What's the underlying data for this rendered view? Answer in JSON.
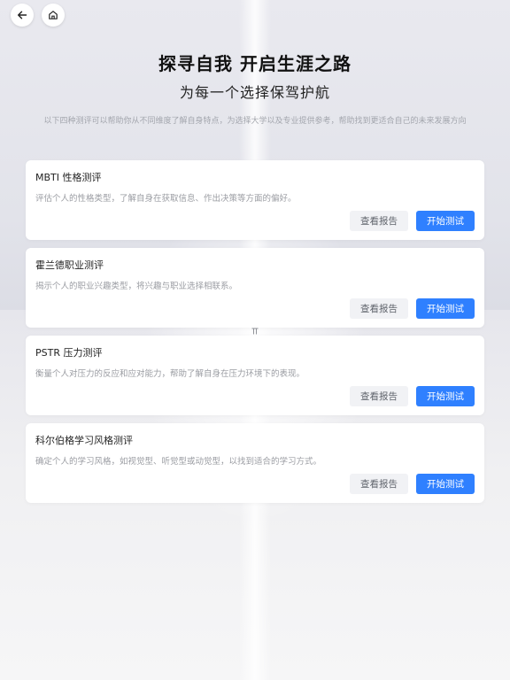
{
  "header": {
    "title": "探寻自我 开启生涯之路",
    "subtitle": "为每一个选择保驾护航",
    "description": "以下四种测评可以帮助你从不同维度了解自身特点，为选择大学以及专业提供参考，帮助找到更适合自己的未来发展方向"
  },
  "nav": {
    "back_icon": "arrow-left-icon",
    "home_icon": "home-icon"
  },
  "colors": {
    "accent": "#2f80ff",
    "report_bg": "#f1f2f5"
  },
  "cards": [
    {
      "title": "MBTI 性格测评",
      "desc": "评估个人的性格类型，了解自身在获取信息、作出决策等方面的偏好。",
      "report_label": "查看报告",
      "start_label": "开始测试"
    },
    {
      "title": "霍兰德职业测评",
      "desc": "揭示个人的职业兴趣类型，将兴趣与职业选择相联系。",
      "report_label": "查看报告",
      "start_label": "开始测试"
    },
    {
      "title": "PSTR 压力测评",
      "desc": "衡量个人对压力的反应和应对能力，帮助了解自身在压力环境下的表现。",
      "report_label": "查看报告",
      "start_label": "开始测试"
    },
    {
      "title": "科尔伯格学习风格测评",
      "desc": "确定个人的学习风格，如视觉型、听觉型或动觉型，以找到适合的学习方式。",
      "report_label": "查看报告",
      "start_label": "开始测试"
    }
  ]
}
